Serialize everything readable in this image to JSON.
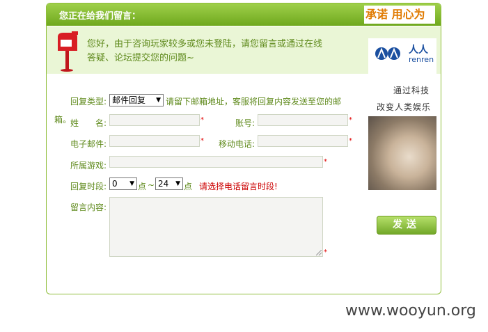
{
  "header": {
    "title": "您正在给我们留言：",
    "promo": "承诺 用心为"
  },
  "notice": {
    "text": "您好，由于咨询玩家较多或您未登陆，请您留言或通过在线答疑、论坛提交您的问题~"
  },
  "form": {
    "reply_type": {
      "label": "回复类型:",
      "value": "邮件回复",
      "hint": "请留下邮箱地址，客服将回复内容发送至您的邮",
      "hint_wrap": "箱。"
    },
    "name": {
      "label": "姓　　名:",
      "value": ""
    },
    "account": {
      "label": "账号:",
      "value": ""
    },
    "email": {
      "label": "电子邮件:",
      "value": ""
    },
    "phone": {
      "label": "移动电话:",
      "value": ""
    },
    "game": {
      "label": "所属游戏:",
      "value": ""
    },
    "reply_time": {
      "label": "回复时段:",
      "from": "0",
      "from_unit": "点",
      "sep": "~",
      "to": "24",
      "to_unit": "点",
      "warning": "请选择电话留言时段!"
    },
    "message": {
      "label": "留言内容:",
      "value": ""
    },
    "required_mark": "*"
  },
  "ad": {
    "brand": "人人",
    "brand_en": "renren",
    "line1": "通过科技",
    "line2": "改变人类娱乐"
  },
  "actions": {
    "send_label": "发送"
  },
  "watermark": "www.wooyun.org",
  "colors": {
    "header_green": "#7cb52a",
    "notice_bg": "#eaf6d6",
    "warning_red": "#cc0000",
    "label_green": "#5f8a1c"
  }
}
